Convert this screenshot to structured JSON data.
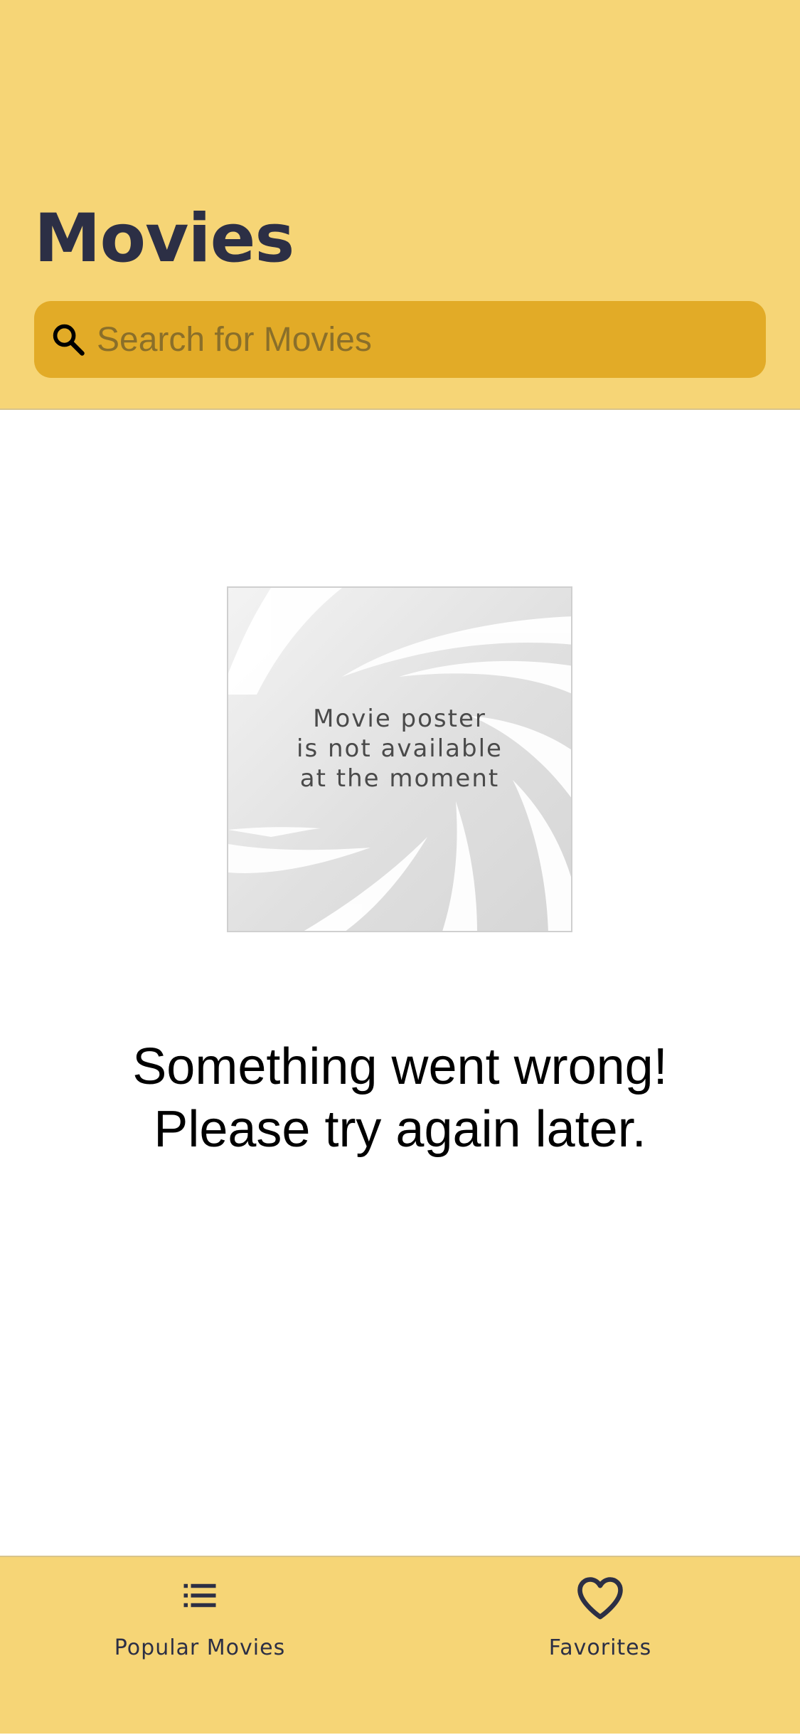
{
  "header": {
    "title": "Movies",
    "search": {
      "placeholder": "Search for Movies",
      "value": ""
    }
  },
  "poster": {
    "text": "Movie poster\nis not available\nat the moment"
  },
  "error": {
    "message": "Something went wrong!\nPlease try again later."
  },
  "tab_bar": {
    "tabs": [
      {
        "label": "Popular Movies",
        "icon": "list-icon"
      },
      {
        "label": "Favorites",
        "icon": "heart-icon"
      }
    ]
  },
  "colors": {
    "header_background": "#f6d576",
    "search_background": "#e2ab27",
    "title_color": "#2c2f45"
  }
}
